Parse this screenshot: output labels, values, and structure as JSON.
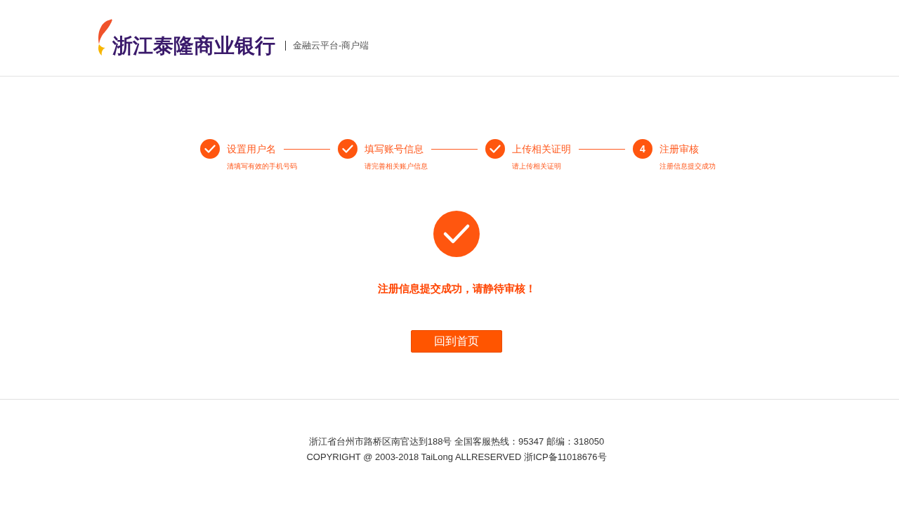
{
  "header": {
    "logo_text": "浙江泰隆商业银行",
    "platform": "金融云平台-商户端"
  },
  "steps": [
    {
      "title": "设置用户名",
      "subtitle": "清填写有效的手机号码",
      "completed": true
    },
    {
      "title": "填写账号信息",
      "subtitle": "请完善相关账户信息",
      "completed": true
    },
    {
      "title": "上传相关证明",
      "subtitle": "请上传相关证明",
      "completed": true
    },
    {
      "title": "注册审核",
      "subtitle": "注册信息提交成功",
      "completed": false,
      "number": "4"
    }
  ],
  "result": {
    "message": "注册信息提交成功，请静待审核！",
    "button": "回到首页"
  },
  "footer": {
    "lines": [
      "浙江省台州市路桥区南官达到188号 全国客服热线：95347 邮编：318050",
      "COPYRIGHT @ 2003-2018 TaiLong ALLRESERVED 浙ICP备11018676号"
    ]
  }
}
